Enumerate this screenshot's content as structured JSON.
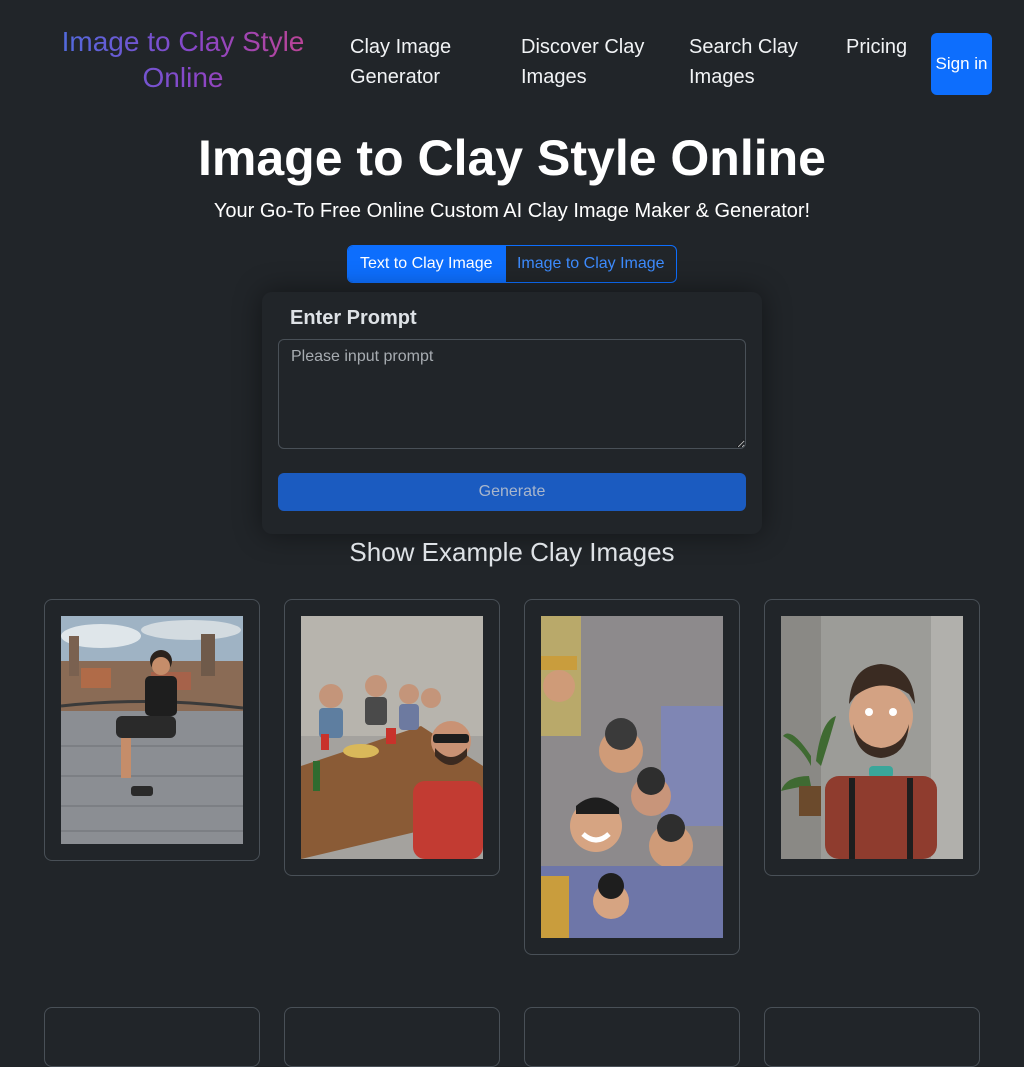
{
  "navbar": {
    "brand": "Image to Clay Style Online",
    "links": [
      "Clay Image Generator",
      "Discover Clay Images",
      "Search Clay Images",
      "Pricing"
    ],
    "signin_label": "Sign in"
  },
  "hero": {
    "title": "Image to Clay Style Online",
    "subtitle": "Your Go-To Free Online Custom AI Clay Image Maker & Generator!"
  },
  "mode_tabs": {
    "active": "Text to Clay Image",
    "inactive": "Image to Clay Image"
  },
  "prompt": {
    "label": "Enter Prompt",
    "placeholder": "Please input prompt",
    "value": ""
  },
  "generate_label": "Generate",
  "examples": {
    "title": "Show Example Clay Images",
    "items": [
      "clay-man-sitting-on-rooftop-terrace",
      "clay-friends-dining-at-table",
      "clay-group-selfie",
      "clay-man-with-bow-tie-and-suspenders"
    ]
  },
  "colors": {
    "background": "#212529",
    "primary": "#0d6efd",
    "brand_gradient": [
      "#4a6fe0",
      "#8a46c8",
      "#c2448e"
    ]
  }
}
